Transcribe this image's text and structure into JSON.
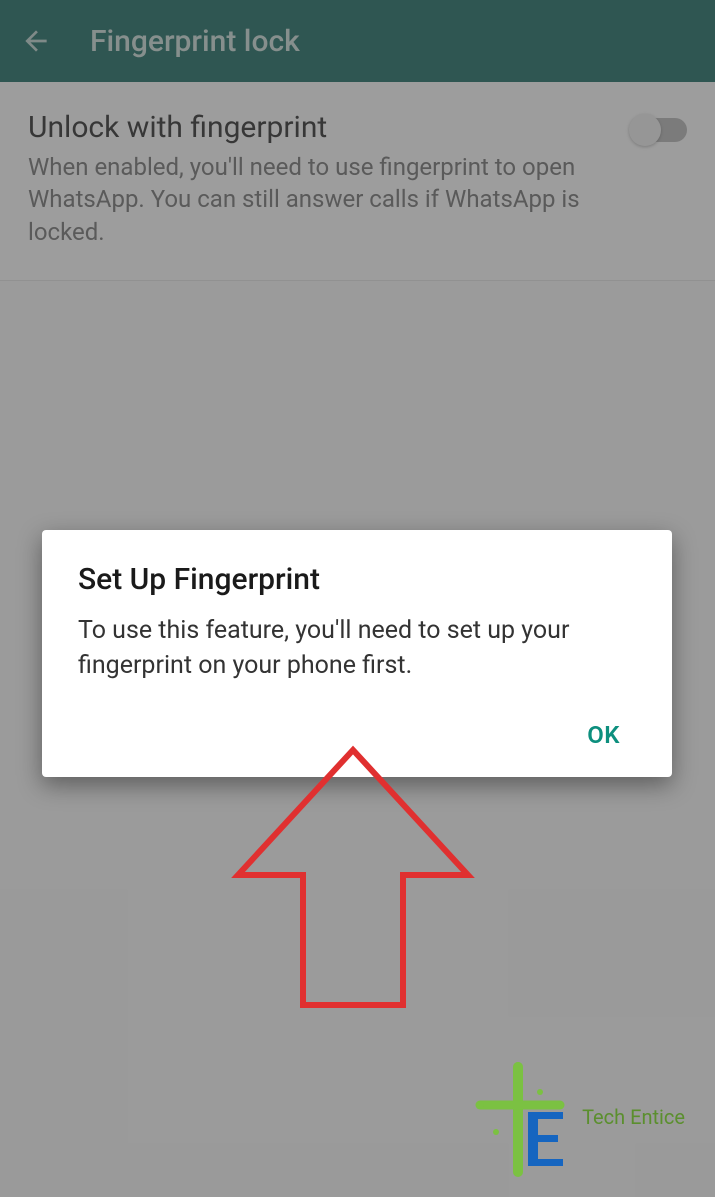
{
  "header": {
    "title": "Fingerprint lock"
  },
  "setting": {
    "title": "Unlock with fingerprint",
    "description": "When enabled, you'll need to use fingerprint to open WhatsApp. You can still answer calls if WhatsApp is locked."
  },
  "dialog": {
    "title": "Set Up Fingerprint",
    "message": "To use this feature, you'll need to set up your fingerprint on your phone first.",
    "ok_label": "OK"
  },
  "watermark": {
    "text": "Tech Entice"
  }
}
